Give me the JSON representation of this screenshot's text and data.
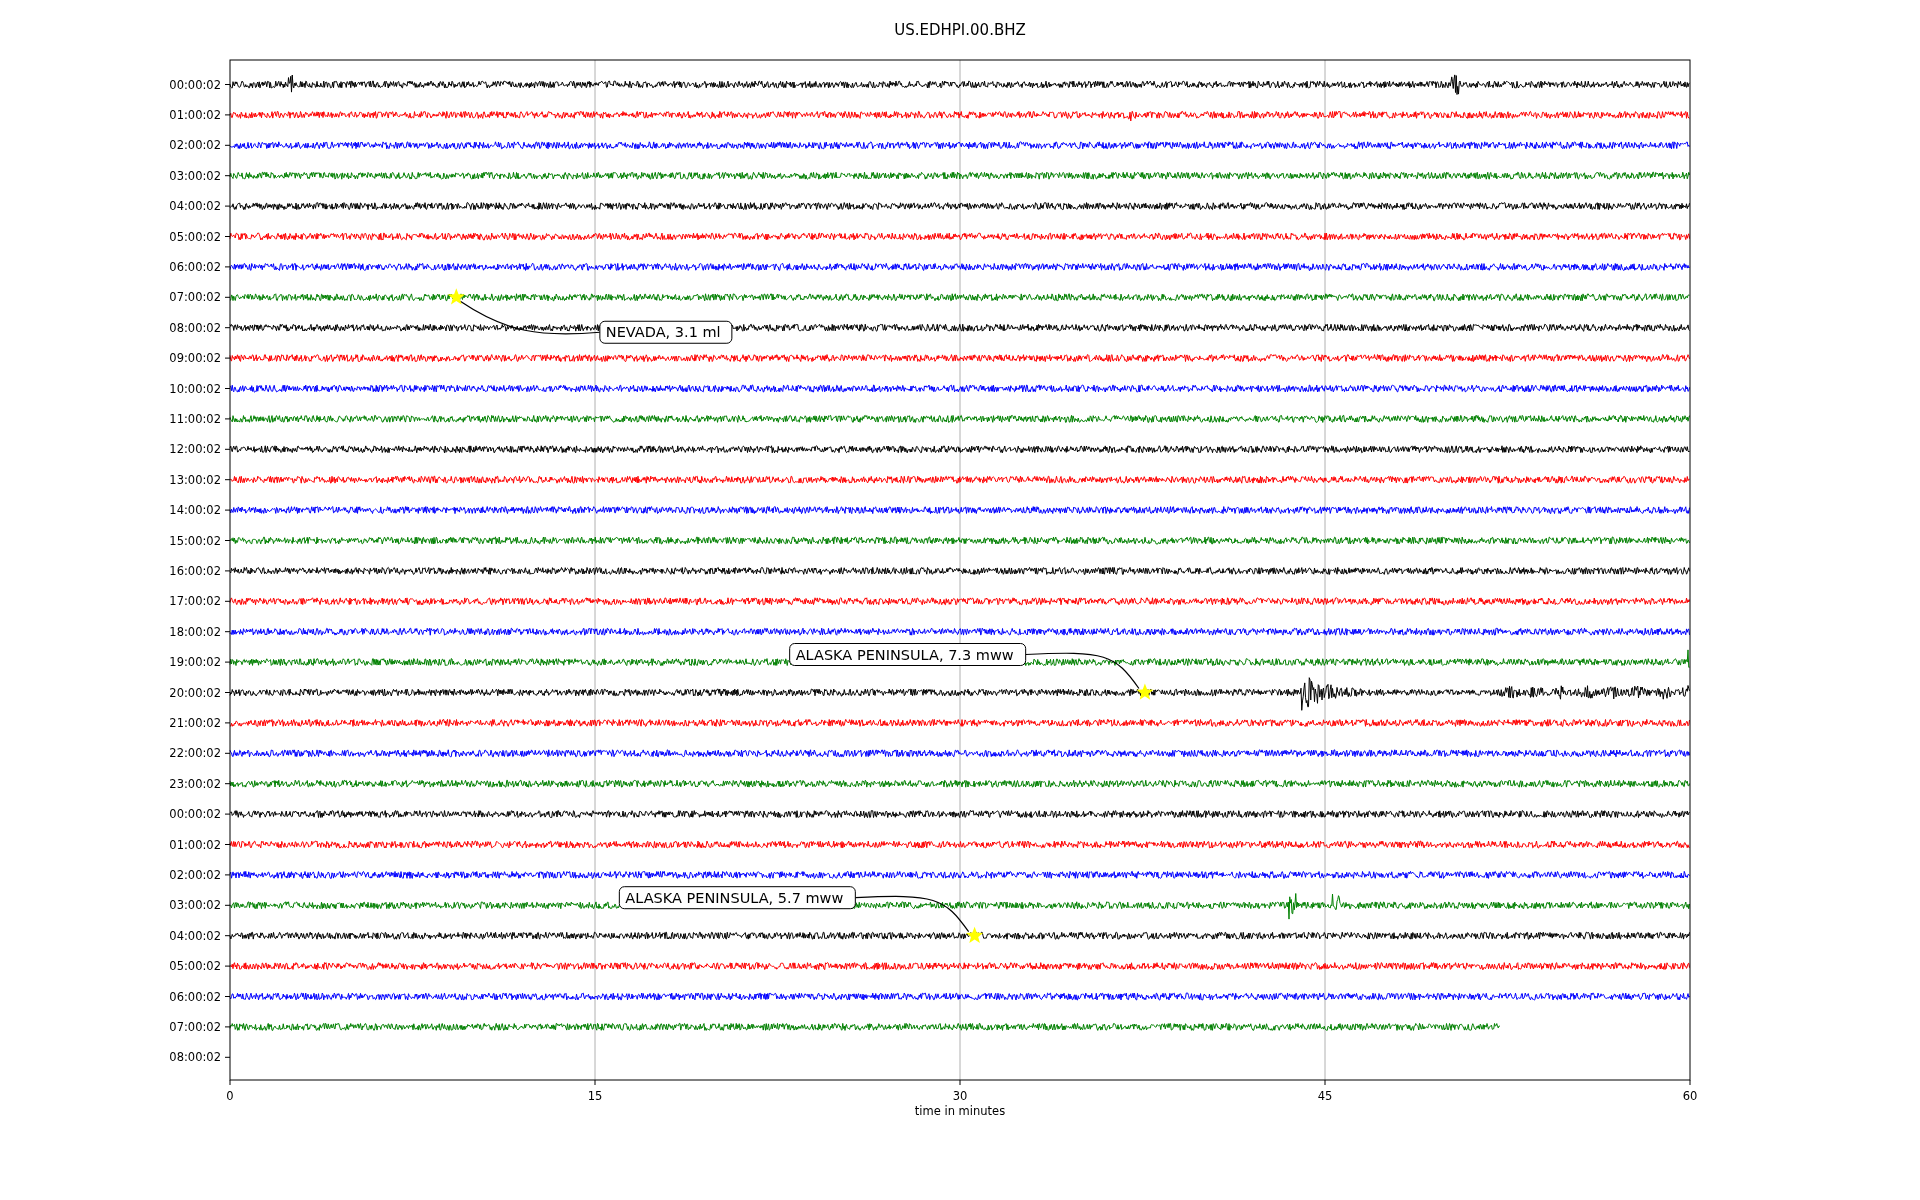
{
  "title": "US.EDHPI.00.BHZ",
  "plot": {
    "row_labels": [
      "00:00:02",
      "01:00:02",
      "02:00:02",
      "03:00:02",
      "04:00:02",
      "05:00:02",
      "06:00:02",
      "07:00:02",
      "08:00:02",
      "09:00:02",
      "10:00:02",
      "11:00:02",
      "12:00:02",
      "13:00:02",
      "14:00:02",
      "15:00:02",
      "16:00:02",
      "17:00:02",
      "18:00:02",
      "19:00:02",
      "20:00:02",
      "21:00:02",
      "22:00:02",
      "23:00:02",
      "00:00:02",
      "01:00:02",
      "02:00:02",
      "03:00:02",
      "04:00:02",
      "05:00:02",
      "06:00:02",
      "07:00:02",
      "08:00:02"
    ],
    "x_ticks": [
      "0",
      "15",
      "30",
      "45",
      "60"
    ],
    "xlabel": "time in minutes",
    "traces": [
      {
        "color": "#000000",
        "level": 1
      },
      {
        "color": "#ff0000",
        "level": 1
      },
      {
        "color": "#0000ff",
        "level": 1
      },
      {
        "color": "#008000",
        "level": 1
      },
      {
        "color": "#000000",
        "level": 1
      },
      {
        "color": "#ff0000",
        "level": 1
      },
      {
        "color": "#0000ff",
        "level": 1
      },
      {
        "color": "#008000",
        "level": 1
      },
      {
        "color": "#000000",
        "level": 1
      },
      {
        "color": "#ff0000",
        "level": 1
      },
      {
        "color": "#0000ff",
        "level": 1
      },
      {
        "color": "#008000",
        "level": 1
      },
      {
        "color": "#000000",
        "level": 1
      },
      {
        "color": "#ff0000",
        "level": 1
      },
      {
        "color": "#0000ff",
        "level": 1
      },
      {
        "color": "#008000",
        "level": 1
      },
      {
        "color": "#000000",
        "level": 1
      },
      {
        "color": "#ff0000",
        "level": 1
      },
      {
        "color": "#0000ff",
        "level": 1
      },
      {
        "color": "#008000",
        "level": 1
      },
      {
        "color": "#000000",
        "level": 1
      },
      {
        "color": "#ff0000",
        "level": 1
      },
      {
        "color": "#0000ff",
        "level": 1
      },
      {
        "color": "#008000",
        "level": 1
      },
      {
        "color": "#000000",
        "level": 1
      },
      {
        "color": "#ff0000",
        "level": 1
      },
      {
        "color": "#0000ff",
        "level": 1
      },
      {
        "color": "#008000",
        "level": 1
      },
      {
        "color": "#000000",
        "level": 1
      },
      {
        "color": "#ff0000",
        "level": 1
      },
      {
        "color": "#0000ff",
        "level": 1
      },
      {
        "color": "#008000",
        "level": 0.87
      }
    ],
    "events": [
      {
        "label": "NEVADA, 3.1 ml"
      },
      {
        "label": "ALASKA PENINSULA, 7.3 mww"
      },
      {
        "label": "ALASKA PENINSULA, 5.7 mww"
      }
    ]
  }
}
